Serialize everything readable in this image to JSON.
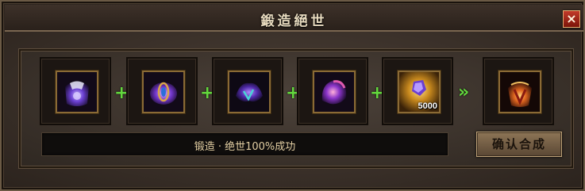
{
  "window": {
    "title": "鍛造絕世",
    "close_label": "×"
  },
  "recipe": {
    "slots": [
      {
        "icon": "armor-chest-icon"
      },
      {
        "icon": "amulet-icon"
      },
      {
        "icon": "gauntlet-icon"
      },
      {
        "icon": "helmet-icon"
      },
      {
        "icon": "forging-stone-icon",
        "quantity": "5000"
      }
    ],
    "plus_symbol": "+",
    "result_arrow": "»",
    "result": {
      "icon": "flame-armor-icon"
    }
  },
  "status": {
    "text": "锻造 · 绝世100%成功"
  },
  "actions": {
    "confirm_label": "确认合成"
  },
  "colors": {
    "accent_green": "#63d83d",
    "close_red": "#c23a2a",
    "gold_border": "#8a6a35",
    "title_text": "#e9dcc0"
  }
}
